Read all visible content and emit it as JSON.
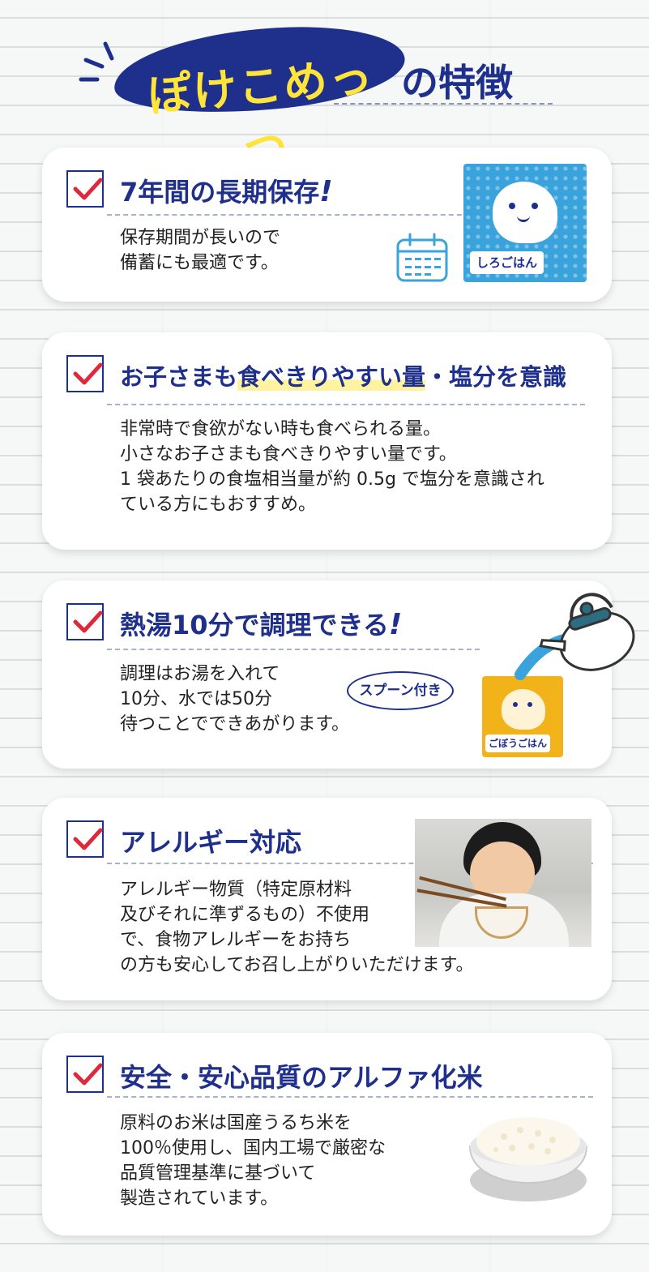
{
  "header": {
    "title_main": "ぽけこめっつ",
    "title_suffix": "の特徴"
  },
  "cards": [
    {
      "heading": "7年間の長期保存",
      "body": [
        "保存期間が長いので",
        "備蓄にも最適です。"
      ],
      "package_label": "しろごはん"
    },
    {
      "heading_plain": "お子さまも",
      "heading_highlight": "食べきりやすい量",
      "heading_rest": "・塩分を意識",
      "body": [
        "非常時で食欲がない時も食べられる量。",
        "小さなお子さまも食べきりやすい量です。",
        "1 袋あたりの食塩相当量が約 0.5g で塩分を意識され",
        "ている方にもおすすめ。"
      ]
    },
    {
      "heading": "熱湯10分で調理できる",
      "body": [
        "調理はお湯を入れて",
        "10分、水では50分",
        "待つことでできあがります。"
      ],
      "badge": "スプーン付き",
      "package_label": "ごぼうごはん"
    },
    {
      "heading": "アレルギー対応",
      "body": [
        "アレルギー物質（特定原材料",
        "及びそれに準ずるもの）不使用",
        "で、食物アレルギーをお持ち",
        "の方も安心してお召し上がりいただけます。"
      ]
    },
    {
      "heading": "安全・安心品質のアルファ化米",
      "body": [
        "原料のお米は国産うるち米を",
        "100％使用し、国内工場で厳密な",
        "品質管理基準に基づいて",
        "製造されています。"
      ]
    }
  ],
  "colors": {
    "navy": "#1e2f8c",
    "yellow": "#ffe43a",
    "check_red": "#e0283c",
    "package_blue": "#3aa3dc",
    "package_orange": "#f2b21a"
  },
  "icons": [
    "check-icon",
    "exclamation-icon",
    "calendar-icon",
    "kettle-icon"
  ]
}
